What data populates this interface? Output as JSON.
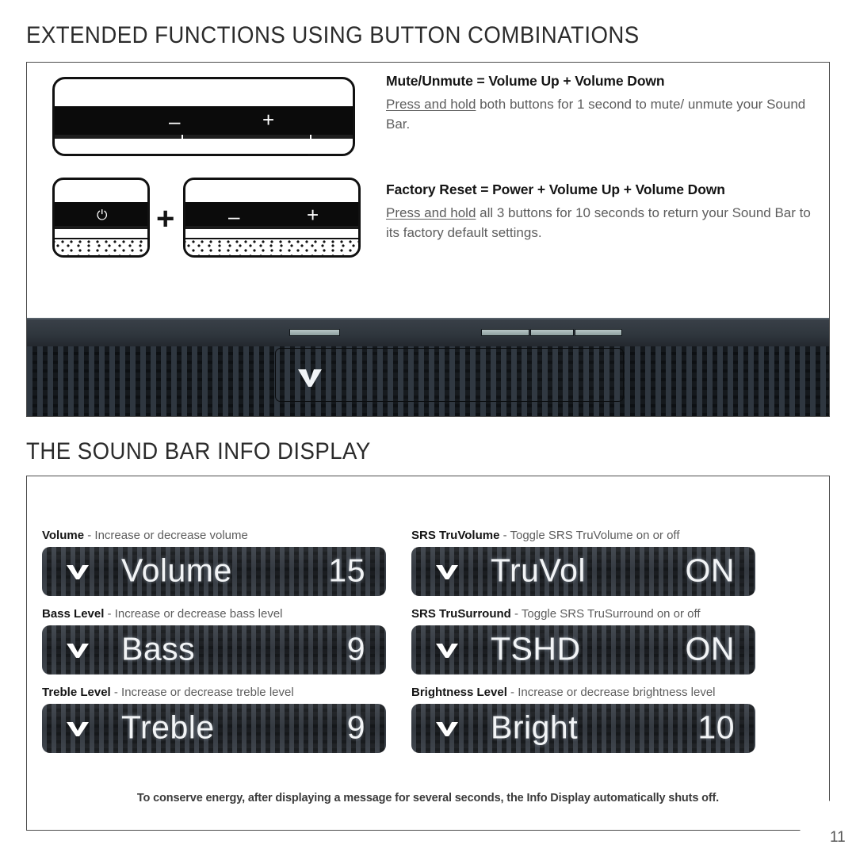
{
  "sections": {
    "extended": {
      "title": "EXTENDED FUNCTIONS USING BUTTON COMBINATIONS",
      "items": [
        {
          "heading": "Mute/Unmute = Volume Up + Volume Down",
          "emphasis": "Press and hold",
          "body": " both buttons for 1 second to mute/ unmute your Sound Bar."
        },
        {
          "heading": "Factory Reset = Power + Volume Up + Volume Down",
          "emphasis": "Press and hold",
          "body": " all 3 buttons for 10 seconds to return your Sound Bar to its factory default settings."
        }
      ],
      "illustration": {
        "minus_glyph": "–",
        "plus_glyph": "+",
        "power_glyph": "⏻",
        "combine_glyph": "+"
      }
    },
    "info_display": {
      "title": "THE SOUND BAR INFO DISPLAY",
      "entries": [
        {
          "label_bold": "Volume",
          "label_rest": " - Increase or decrease volume",
          "screen_text": "Volume",
          "screen_value": "15"
        },
        {
          "label_bold": "SRS TruVolume",
          "label_rest": " - Toggle SRS TruVolume on or off",
          "screen_text": "TruVol",
          "screen_value": "ON"
        },
        {
          "label_bold": "Bass Level",
          "label_rest": " - Increase or decrease bass level",
          "screen_text": "Bass",
          "screen_value": "9"
        },
        {
          "label_bold": "SRS TruSurround",
          "label_rest": " - Toggle SRS TruSurround on or off",
          "screen_text": "TSHD",
          "screen_value": "ON"
        },
        {
          "label_bold": "Treble Level",
          "label_rest": " - Increase or decrease treble level",
          "screen_text": "Treble",
          "screen_value": "9"
        },
        {
          "label_bold": "Brightness Level",
          "label_rest": " - Increase or decrease brightness level",
          "screen_text": "Bright",
          "screen_value": "10"
        }
      ],
      "footer_note": "To conserve energy, after displaying a message for several seconds, the Info Display automatically shuts off."
    }
  },
  "page_number": "11",
  "colors": {
    "heading": "#2b2b2b",
    "body_text": "#5d5d5d",
    "bold_text": "#151515",
    "display_bg": "#1c1f23",
    "display_text": "#f2f4f6",
    "border": "#4c4c4c"
  }
}
